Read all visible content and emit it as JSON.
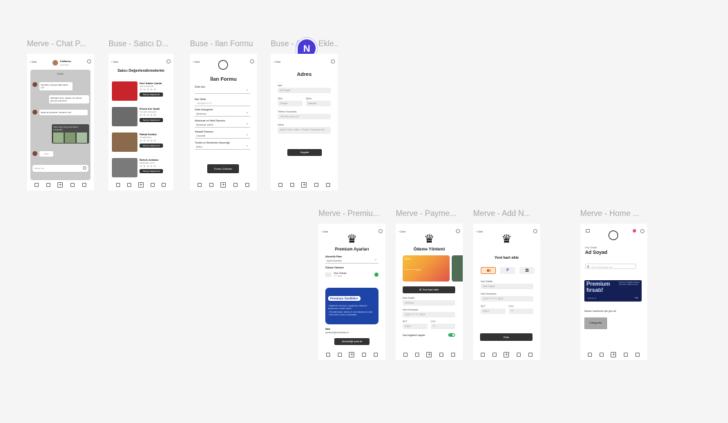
{
  "labels": {
    "chat": "Merve - Chat P...",
    "seller": "Buse - Satıcı D...",
    "ilan": "Buse - İlan Formu",
    "adres": "Buse - Adres Ekle...",
    "premium": "Merve - Premiu...",
    "payment": "Merve - Payme...",
    "addcard": "Merve - Add N...",
    "home": "Merve - Home ..."
  },
  "avatar_letter": "N",
  "chat": {
    "back": "Geri",
    "name": "Kullanıcı",
    "status": "Çevrimiçi",
    "day": "Bugün",
    "m1": "Merhaba, çantaya hâlâ satılık mı?",
    "m2": "Merhaba. Evet, satışta. Ne zaman görmek istersiniz?",
    "m3": "Kargo ile gönderim mümkün mü?",
    "m4": "Tabii, kargo ile gönderebilirim. Fotoğraflar:",
    "typing": "• • •",
    "input": "Mesaj yaz..."
  },
  "seller": {
    "back": "Geri",
    "title": "Satıcı Değerlendirmelerim",
    "items": [
      {
        "name": "Deri Kadın Çanta",
        "sub": "Çok iyi durumda",
        "stars": "☆☆☆☆☆",
        "btn": "Satıcıyı Değerlendir"
      },
      {
        "name": "Erkek Kol Saati",
        "sub": "Yeni gibi, kutusuyla",
        "stars": "☆☆☆☆☆",
        "btn": "Satıcıyı Değerlendir"
      },
      {
        "name": "Rahat Koltuk",
        "sub": "Az kullanılmış",
        "stars": "☆☆☆☆☆",
        "btn": "Satıcıyı Değerlendir"
      },
      {
        "name": "Bebek Arabası",
        "sub": "Katlanabilir, temiz",
        "stars": "☆☆☆☆☆",
        "btn": "Satıcıyı Değerlendir"
      }
    ]
  },
  "ilan": {
    "back": "Geri",
    "title": "İlan Formu",
    "f1": "Ürün Adı",
    "f2": "İlan Tarihi",
    "f2v": "GG/AA/YYYY",
    "f3": "Ürün Kategorisi",
    "f3v": "Aksesuar",
    "f4": "Aksesuar ve Hobi Durumu",
    "f4v": "Aksesuar sahibi",
    "f5": "Garanti Durumu",
    "f5v": "Garantili",
    "f6": "Teslim ve Gönderme Seçeneği",
    "f6v": "Elden",
    "btn": "Formu Gönder"
  },
  "adres": {
    "back": "Geri",
    "title": "Adres",
    "f1": "İsim",
    "f1v": "Ad Soyad",
    "f2": "Ülke",
    "f2v": "Türkiye",
    "f3": "Şehir",
    "f3v": "İstanbul",
    "f4": "Telefon Numarası",
    "f4v": "+90 5xx xxx xx xx",
    "f5": "Adres",
    "f5v": "Adresi Yazın, Mah. / Sokak / Apartman No",
    "btn": "Kaydet"
  },
  "premium": {
    "back": "Geri",
    "title": "Premium Ayarları",
    "plan_label": "Abonelik Planı",
    "plan": "Aylık Abonelik",
    "pay_label": "Ödeme Yöntemi",
    "card_name": "Visa Classic",
    "card_num": "**** 4321",
    "feat_title": "Premium Özellikler",
    "feats": [
      "• Reklamsız deneyim, uygulamayı reklamsız kullanmanın keyfini çıkarın.",
      "• Öncelikli ilanlar, ilanlarınız üst sıralarda öne çıkar.",
      "• Özel satıcı rozeti ve istatistikler."
    ],
    "mail_label": "Mail",
    "mail": "premium@ornekmail.co",
    "btn": "Aboneliği iptal et"
  },
  "payment": {
    "back": "Geri",
    "title": "Ödeme Yöntemi",
    "card_bank": "Banka",
    "card_num": "**** **** **** 4321",
    "add_card": "⊕ Yeni kart ekle",
    "f1": "Kart Sahibi",
    "f1v": "Kullanıcı",
    "f2": "Kart Numarası",
    "f2v": "1234 **** **** 5678",
    "f3": "SKT",
    "f3v": "03/24",
    "f4": "CVV",
    "f4v": "***",
    "toggle_label": "Kart bilgilerini kaydet"
  },
  "addcard": {
    "back": "Geri",
    "title": "Yeni kart ekle",
    "f1": "Kart Sahibi",
    "f1v": "İsim Soyad",
    "f2": "Kart Numarası",
    "f2v": "1234 **** **** 5678",
    "f3": "SKT",
    "f3v": "03/24",
    "f4": "CVV",
    "f4v": "***",
    "btn": "Ekle"
  },
  "home": {
    "greet": "Hoş Geldin",
    "name": "Ad Soyad",
    "search": "Ürün veya kategori ara...",
    "banner1": "Premium",
    "banner2": "fırsatı!",
    "banner_sub": "Premium üyelikle ilanlarını öne çıkar, reklamsız gez.",
    "banner_link": "Hemen al",
    "hint": "İlanları incelemek için göz at!",
    "cat_btn": "Kategoriler"
  },
  "colors": {
    "premium_box": "#1e44a7",
    "banner": "#142055",
    "card_orange": "#f29d38",
    "toggle": "#2fae55",
    "avatar": "#4a38d8"
  }
}
